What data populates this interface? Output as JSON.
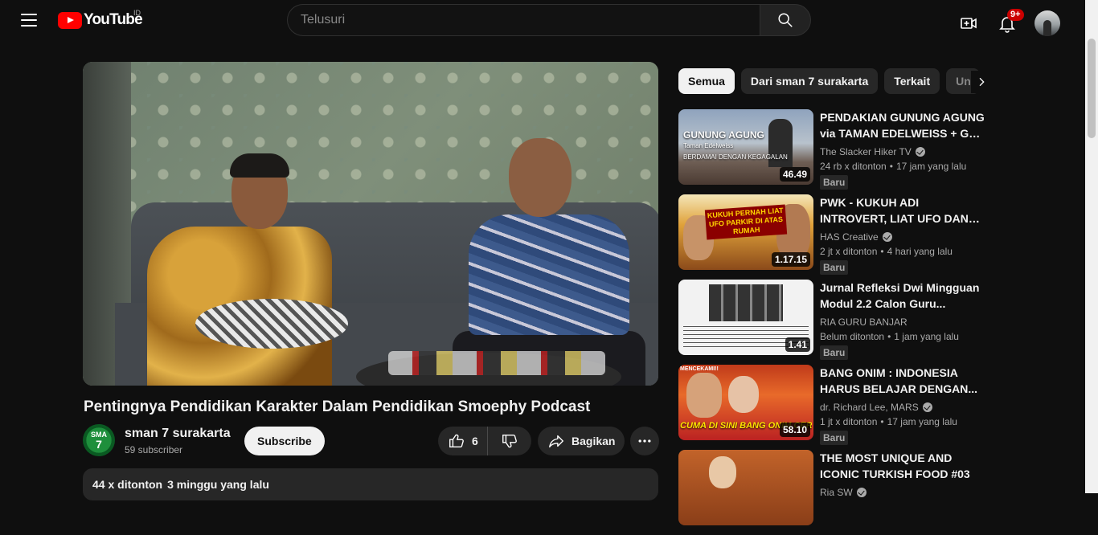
{
  "header": {
    "logo_text": "YouTube",
    "region": "ID",
    "search_placeholder": "Telusuri",
    "notification_count": "9+"
  },
  "video": {
    "title": "Pentingnya Pendidikan Karakter Dalam Pendidikan Smoephy Podcast",
    "channel": {
      "name": "sman 7 surakarta",
      "subscribers": "59 subscriber",
      "avatar_top": "SMA",
      "avatar_num": "7"
    },
    "subscribe_label": "Subscribe",
    "like_count": "6",
    "share_label": "Bagikan",
    "views": "44 x ditonton",
    "age": "3 minggu yang lalu"
  },
  "chips": [
    {
      "label": "Semua",
      "active": true
    },
    {
      "label": "Dari sman 7 surakarta",
      "active": false
    },
    {
      "label": "Terkait",
      "active": false
    },
    {
      "label": "Un",
      "active": false
    }
  ],
  "recommendations": [
    {
      "title": "PENDAKIAN GUNUNG AGUNG via TAMAN EDELWEISS + GPS ...",
      "channel": "The Slacker Hiker TV",
      "verified": true,
      "views": "24 rb x ditonton",
      "age": "17 jam yang lalu",
      "badge": "Baru",
      "duration": "46.49",
      "thumb_text": "GUNUNG AGUNG",
      "thumb_sub1": "Taman Edelweiss",
      "thumb_sub2": "BERDAMAI DENGAN KEGAGALAN"
    },
    {
      "title": "PWK - KUKUH ADI INTROVERT, LIAT UFO DAN BISA...",
      "channel": "HAS Creative",
      "verified": true,
      "views": "2 jt x ditonton",
      "age": "4 hari yang lalu",
      "badge": "Baru",
      "duration": "1.17.15",
      "thumb_text": "KUKUH PERNAH LIAT UFO PARKIR DI ATAS RUMAH"
    },
    {
      "title": "Jurnal Refleksi Dwi Mingguan Modul 2.2 Calon Guru...",
      "channel": "RIA GURU BANJAR",
      "verified": false,
      "views": "Belum ditonton",
      "age": "1 jam yang lalu",
      "badge": "Baru",
      "duration": "1.41"
    },
    {
      "title": "BANG ONIM : INDONESIA HARUS BELAJAR DENGAN...",
      "channel": "dr. Richard Lee, MARS",
      "verified": true,
      "views": "1 jt x ditonton",
      "age": "17 jam yang lalu",
      "badge": "Baru",
      "duration": "58.10",
      "thumb_text": "CUMA DI SINI BANG ONIM CERITA KETAKUTAN",
      "thumb_top": "MENCEKAMI!!"
    },
    {
      "title": "THE MOST UNIQUE AND ICONIC TURKISH FOOD #03",
      "channel": "Ria SW",
      "verified": true,
      "views": "",
      "age": "",
      "badge": "",
      "duration": ""
    }
  ]
}
